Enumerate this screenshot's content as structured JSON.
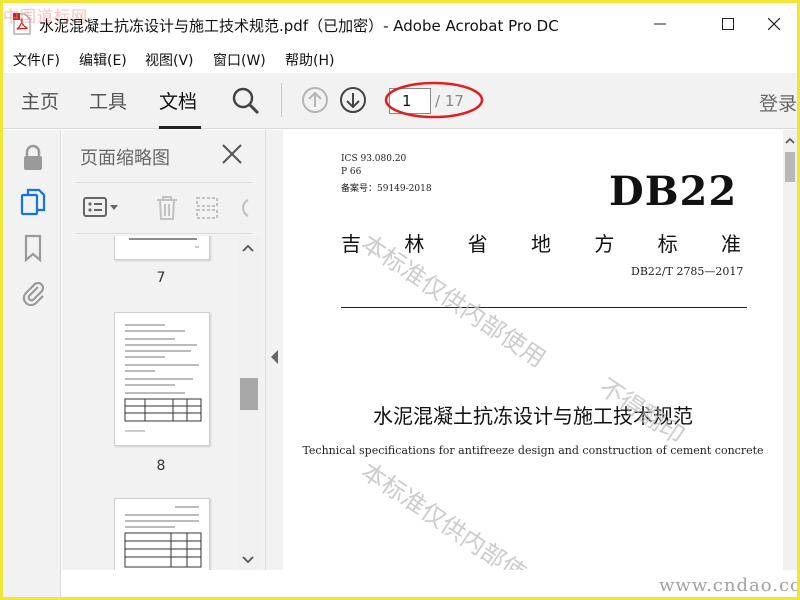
{
  "window": {
    "title": "水泥混凝土抗冻设计与施工技术规范.pdf（已加密）- Adobe Acrobat Pro DC",
    "watermark_top": "中国道标网"
  },
  "menu": [
    "文件(F)",
    "编辑(E)",
    "视图(V)",
    "窗口(W)",
    "帮助(H)"
  ],
  "toolbar": {
    "tabs": [
      "主页",
      "工具",
      "文档"
    ],
    "active_tab": "文档",
    "current_page": "1",
    "total_pages": "/ 17",
    "login": "登录"
  },
  "thumbnail_panel": {
    "title": "页面缩略图",
    "thumbnails": [
      "7",
      "8",
      ""
    ]
  },
  "document": {
    "ics": "ICS 93.080.20",
    "p_code": "P 66",
    "record": "备案号：59149-2018",
    "code_big": "DB22",
    "province_chars": [
      "吉",
      "林",
      "省",
      "地",
      "方",
      "标",
      "准"
    ],
    "standard_number": "DB22/T 2785—2017",
    "title_cn": "水泥混凝土抗冻设计与施工技术规范",
    "title_en": "Technical specifications for antifreeze design and construction of cement concrete",
    "watermarks": [
      "本标准仅供内部使用",
      "不得翻印",
      "本标准仅供内部使"
    ]
  },
  "watermark_bottom": "www.cndao.com",
  "colors": {
    "frame": "#f2e53a",
    "annotation": "#e02020",
    "toolbar": "#f2f2f2"
  }
}
